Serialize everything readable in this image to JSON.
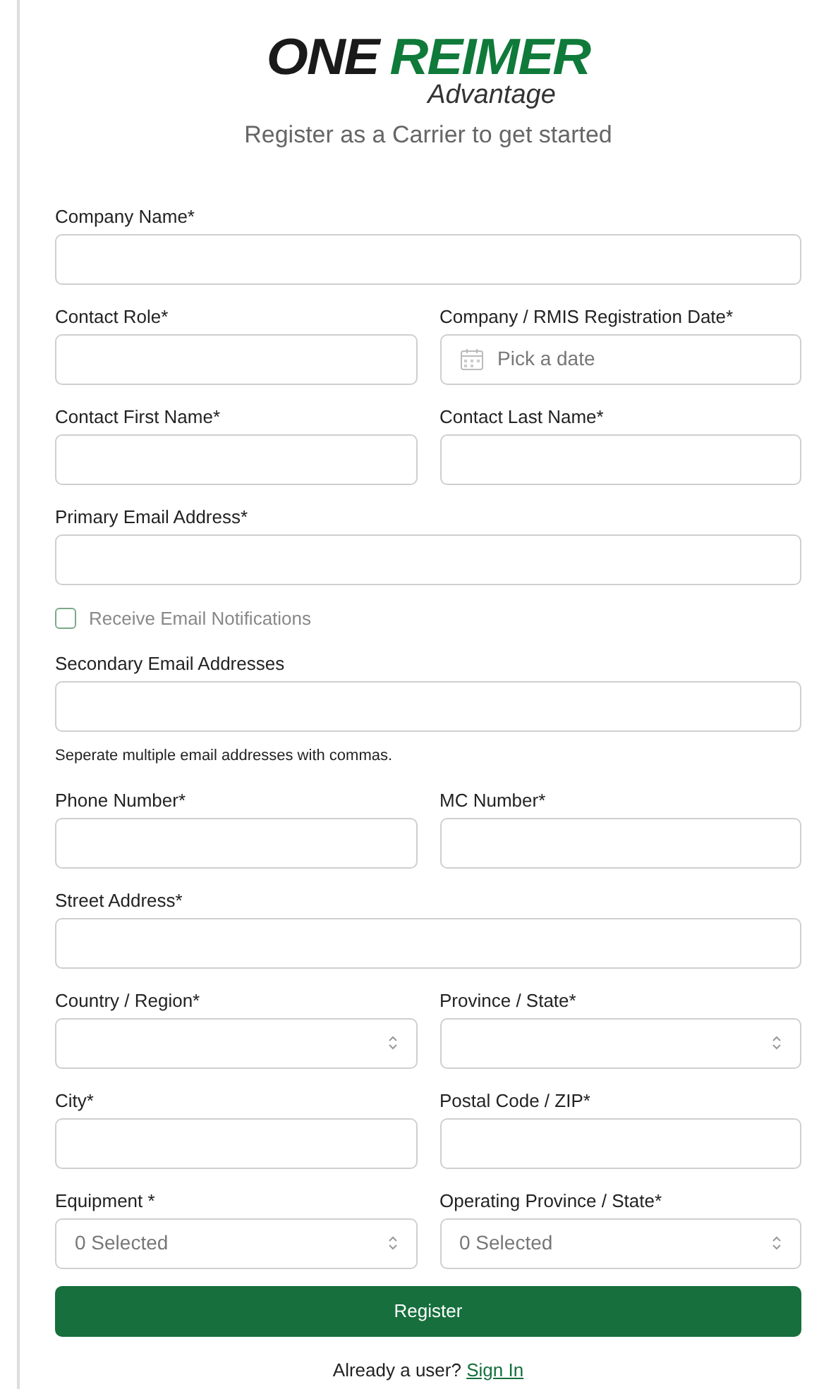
{
  "logo": {
    "word_1": "ONE",
    "word_2": "REIMER",
    "tagline": "Advantage"
  },
  "subtitle": "Register as a Carrier to get started",
  "rows": [
    {
      "fields": [
        {
          "kind": "text",
          "label": "Company Name*"
        }
      ]
    },
    {
      "fields": [
        {
          "kind": "text",
          "label": "Contact Role*"
        },
        {
          "kind": "date",
          "label": "Company / RMIS Registration Date*",
          "placeholder": "Pick a date"
        }
      ]
    },
    {
      "fields": [
        {
          "kind": "text",
          "label": "Contact First Name*"
        },
        {
          "kind": "text",
          "label": "Contact Last Name*"
        }
      ]
    },
    {
      "fields": [
        {
          "kind": "text",
          "label": "Primary Email Address*"
        }
      ]
    },
    {
      "fields": [
        {
          "kind": "checkbox",
          "label": "Receive Email Notifications",
          "checked": false
        }
      ]
    },
    {
      "fields": [
        {
          "kind": "text",
          "label": "Secondary Email Addresses",
          "hint": "Seperate multiple email addresses with commas."
        }
      ]
    },
    {
      "fields": [
        {
          "kind": "text",
          "label": "Phone Number*"
        },
        {
          "kind": "text",
          "label": "MC Number*"
        }
      ]
    },
    {
      "fields": [
        {
          "kind": "text",
          "label": "Street Address*"
        }
      ]
    },
    {
      "fields": [
        {
          "kind": "select",
          "label": "Country / Region*"
        },
        {
          "kind": "select",
          "label": "Province / State*"
        }
      ]
    },
    {
      "fields": [
        {
          "kind": "text",
          "label": "City*"
        },
        {
          "kind": "text",
          "label": "Postal Code / ZIP*"
        }
      ]
    },
    {
      "fields": [
        {
          "kind": "select",
          "label": "Equipment *",
          "value": "0 Selected"
        },
        {
          "kind": "select",
          "label": "Operating Province / State*",
          "value": "0 Selected"
        }
      ]
    }
  ],
  "register_button": "Register",
  "footer": {
    "text": "Already a user?",
    "link": "Sign In"
  }
}
